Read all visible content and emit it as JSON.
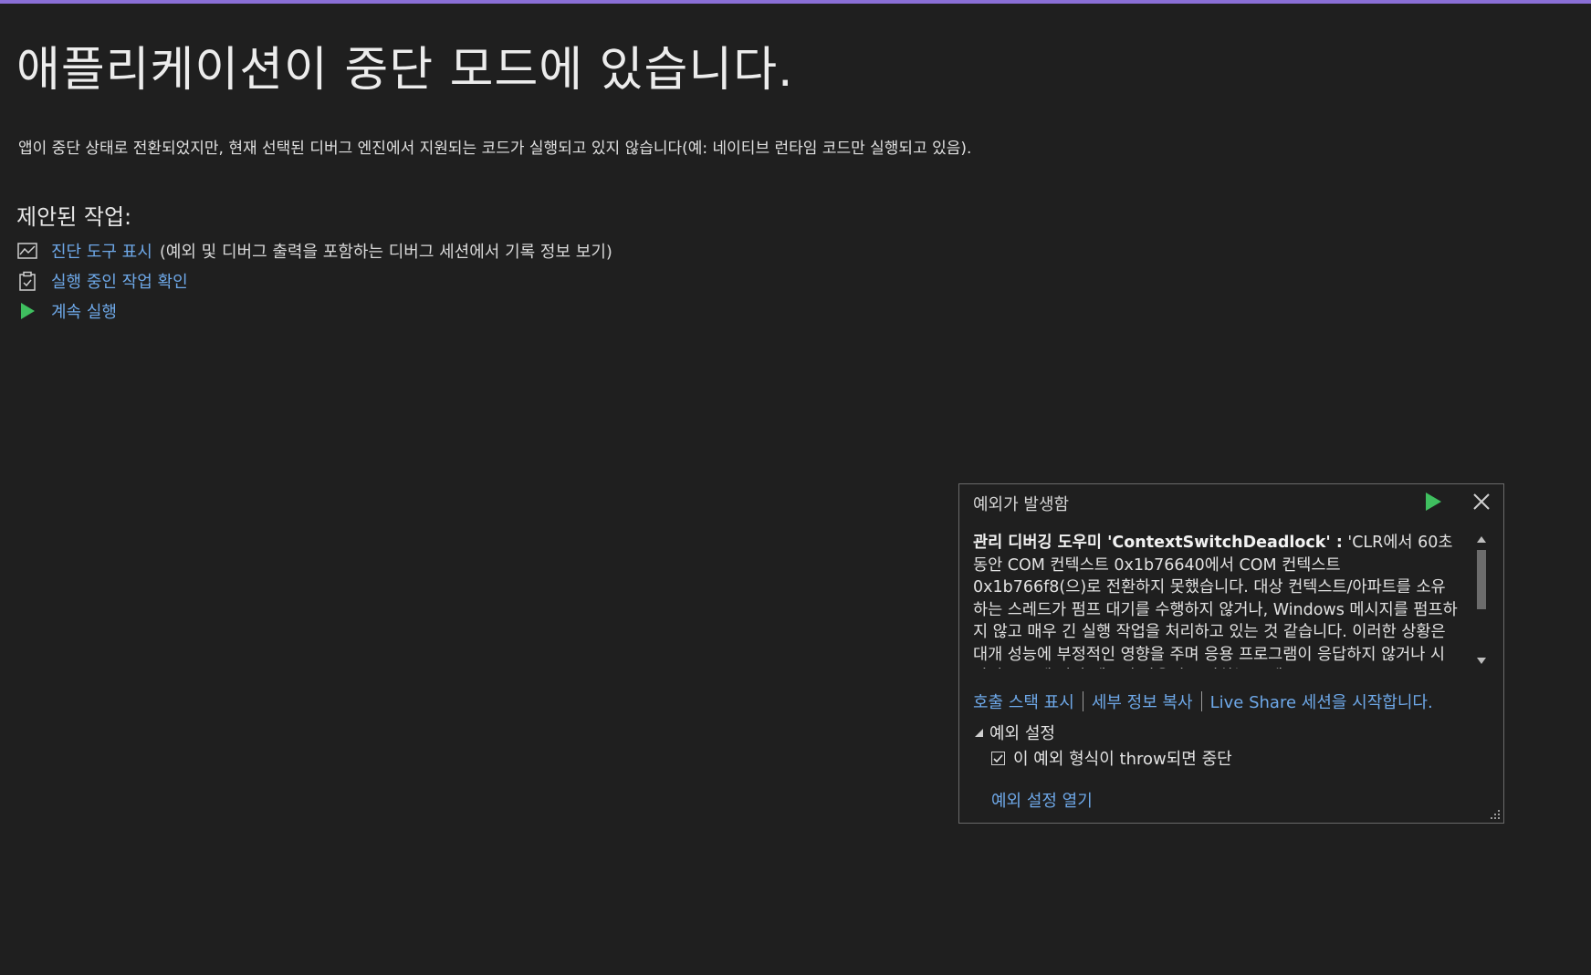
{
  "page": {
    "title": "애플리케이션이 중단 모드에 있습니다.",
    "description": "앱이 중단 상태로 전환되었지만, 현재 선택된 디버그 엔진에서 지원되는 코드가 실행되고 있지 않습니다(예: 네이티브 런타임 코드만 실행되고 있음)."
  },
  "actions": {
    "heading": "제안된 작업:",
    "items": [
      {
        "icon": "chart-icon",
        "label": "진단 도구 표시",
        "hint": "(예외 및 디버그 출력을 포함하는 디버그 세션에서 기록 정보 보기)"
      },
      {
        "icon": "clipboard-icon",
        "label": "실행 중인 작업 확인",
        "hint": ""
      },
      {
        "icon": "play-icon",
        "label": "계속 실행",
        "hint": ""
      }
    ]
  },
  "exception": {
    "title": "예외가 발생함",
    "bold_prefix": "관리 디버깅 도우미 'ContextSwitchDeadlock' :",
    "message": " 'CLR에서 60초 동안 COM 컨텍스트 0x1b76640에서 COM 컨텍스트 0x1b766f8(으)로 전환하지 못했습니다. 대상 컨텍스트/아파트를 소유하는 스레드가 펌프 대기를 수행하지 않거나, Windows 메시지를 펌프하지 않고 매우 긴 실행 작업을 처리하고 있는 것 같습니다. 이러한 상황은 대개 성능에 부정적인 영향을 주며 응용 프로그램이 응답하지 않거나 시간이 소요에 따라 메모리 사용이 증가하는 문제로",
    "links": {
      "call_stack": "호출 스택 표시",
      "copy_details": "세부 정보 복사",
      "live_share": "Live Share 세션을 시작합니다."
    },
    "settings_heading": "예외 설정",
    "checkbox_label": "이 예외 형식이 throw되면 중단",
    "checkbox_checked": true,
    "open_settings": "예외 설정 열기"
  },
  "colors": {
    "background": "#1f1f1f",
    "link": "#6ea8e8",
    "play": "#3fbf5f",
    "accent": "#8a6fd6"
  }
}
